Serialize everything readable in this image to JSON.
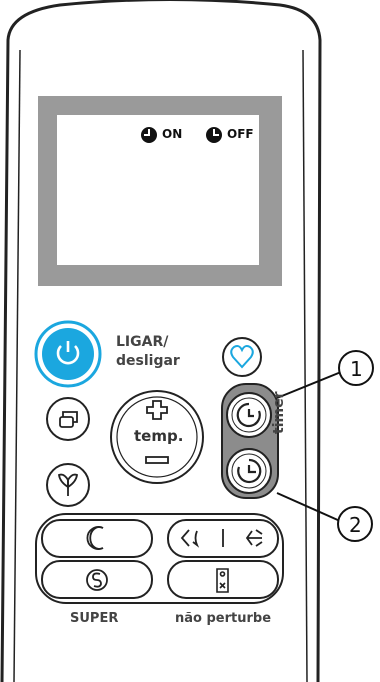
{
  "display": {
    "on_label": "ON",
    "off_label": "OFF"
  },
  "buttons": {
    "power_label_line1": "LIGAR/",
    "power_label_line2": "desligar",
    "temp_label": "temp.",
    "timer_label": "timer",
    "super_label": "SUPER",
    "do_not_disturb_label": "não perturbe"
  },
  "callouts": {
    "callout_1": "1",
    "callout_2": "2"
  },
  "colors": {
    "accent": "#1ba7df",
    "screen": "#ffffff",
    "screen_bezel": "#9a9a9a",
    "timer_panel": "#8c8c8c",
    "outline": "#222222"
  },
  "icons": {
    "power": "power-icon",
    "heart": "heart-icon",
    "mode": "mode-icon",
    "fan": "fan-icon",
    "temp_up": "plus-icon",
    "temp_down": "minus-icon",
    "timer_on": "timer-on-icon",
    "timer_off": "timer-off-icon",
    "sleep": "moon-icon",
    "swing": "swing-icon",
    "super": "super-icon",
    "dnd": "door-hanger-icon"
  }
}
